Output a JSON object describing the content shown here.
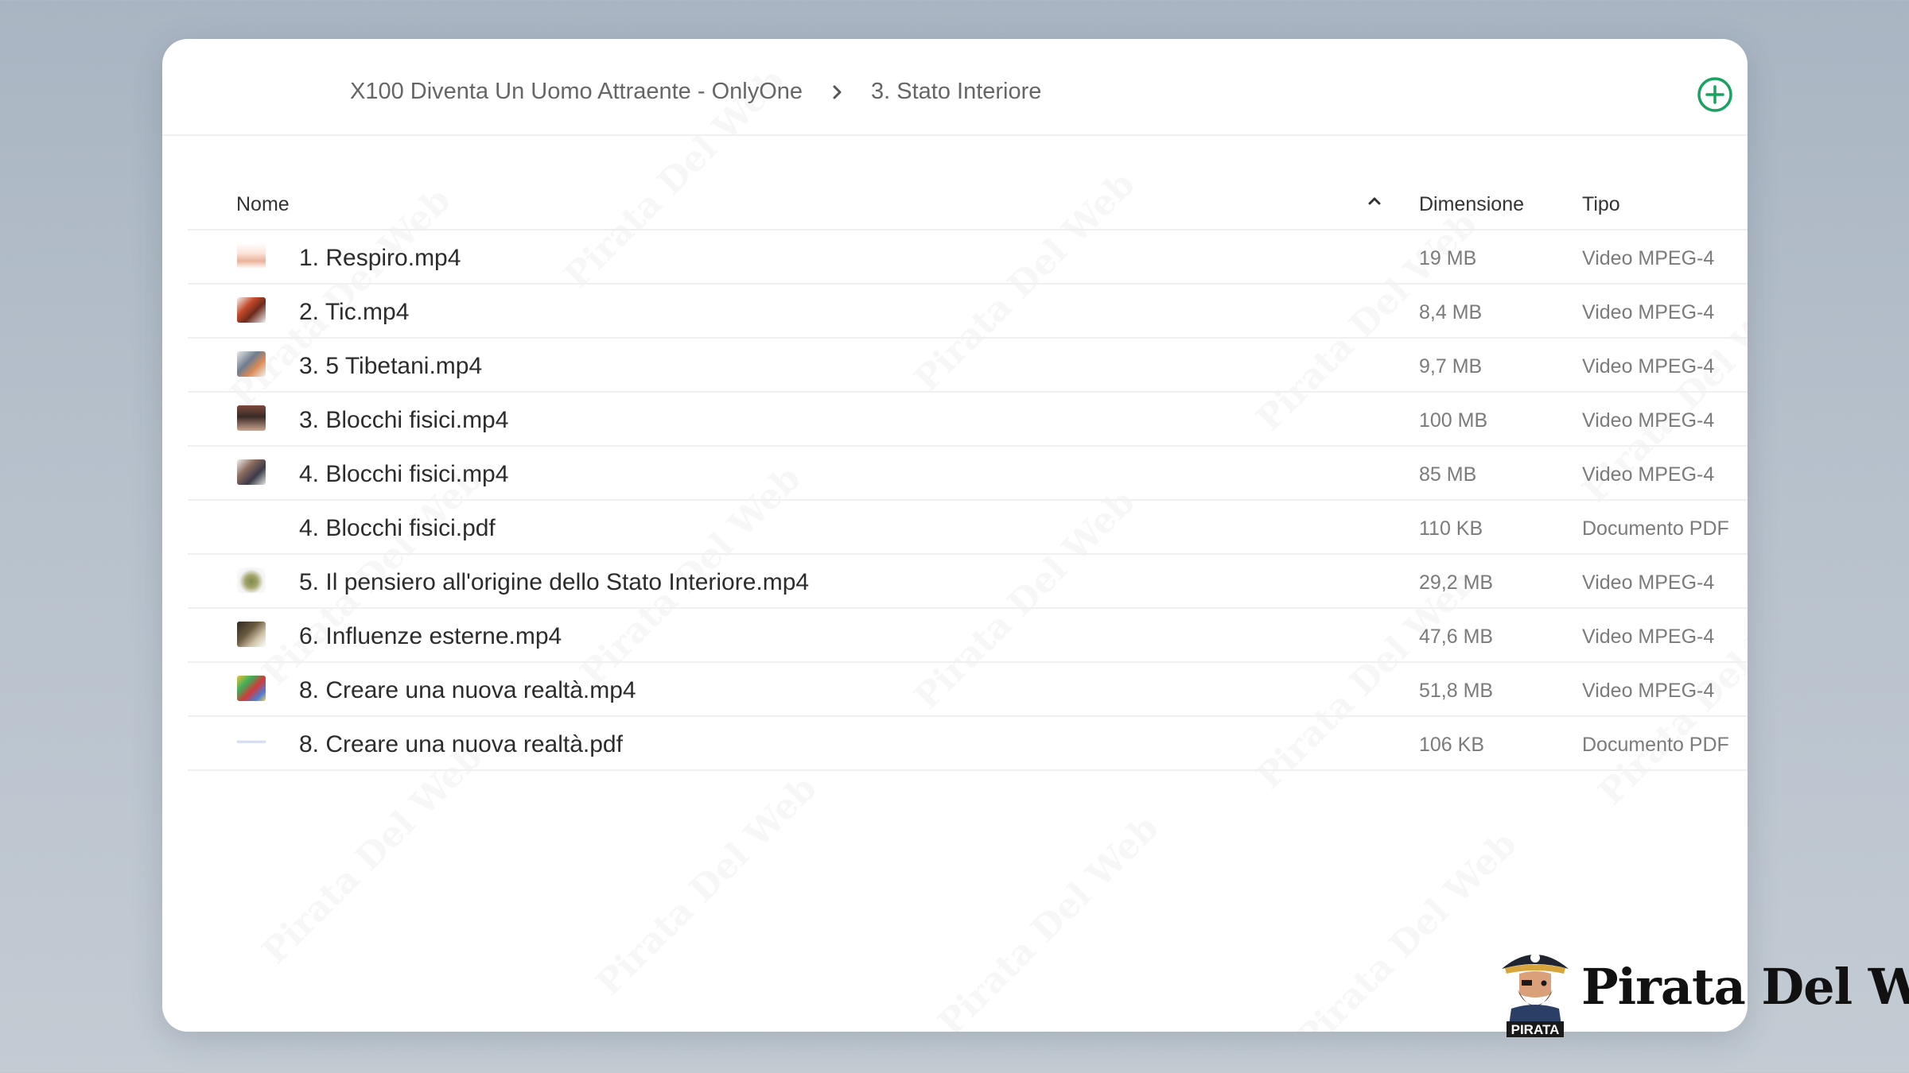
{
  "breadcrumb": {
    "parent": "X100 Diventa Un Uomo Attraente - OnlyOne",
    "current": "3. Stato Interiore"
  },
  "table": {
    "headers": {
      "name": "Nome",
      "size": "Dimensione",
      "type": "Tipo"
    },
    "rows": [
      {
        "name": "1. Respiro.mp4",
        "size": "19 MB",
        "type": "Video MPEG-4"
      },
      {
        "name": "2. Tic.mp4",
        "size": "8,4 MB",
        "type": "Video MPEG-4"
      },
      {
        "name": "3. 5 Tibetani.mp4",
        "size": "9,7 MB",
        "type": "Video MPEG-4"
      },
      {
        "name": "3. Blocchi fisici.mp4",
        "size": "100 MB",
        "type": "Video MPEG-4"
      },
      {
        "name": "4. Blocchi fisici.mp4",
        "size": "85 MB",
        "type": "Video MPEG-4"
      },
      {
        "name": "4. Blocchi fisici.pdf",
        "size": "110 KB",
        "type": "Documento PDF"
      },
      {
        "name": "5. Il pensiero all'origine dello Stato Interiore.mp4",
        "size": "29,2 MB",
        "type": "Video MPEG-4"
      },
      {
        "name": "6. Influenze esterne.mp4",
        "size": "47,6 MB",
        "type": "Video MPEG-4"
      },
      {
        "name": "8. Creare una nuova realtà.mp4",
        "size": "51,8 MB",
        "type": "Video MPEG-4"
      },
      {
        "name": "8. Creare una nuova realtà.pdf",
        "size": "106 KB",
        "type": "Documento PDF"
      }
    ]
  },
  "watermark": {
    "text": "Pirata Del Web"
  },
  "brand": {
    "name": "Pirata Del Web",
    "mascot_label": "PIRATA"
  },
  "icons": {
    "breadcrumb_separator": "chevron-right-icon",
    "add": "plus-circle-icon",
    "sort": "chevron-up-icon"
  },
  "colors": {
    "accent": "#1aa260",
    "text": "#2c2c2c",
    "muted": "#7b7b7b"
  }
}
